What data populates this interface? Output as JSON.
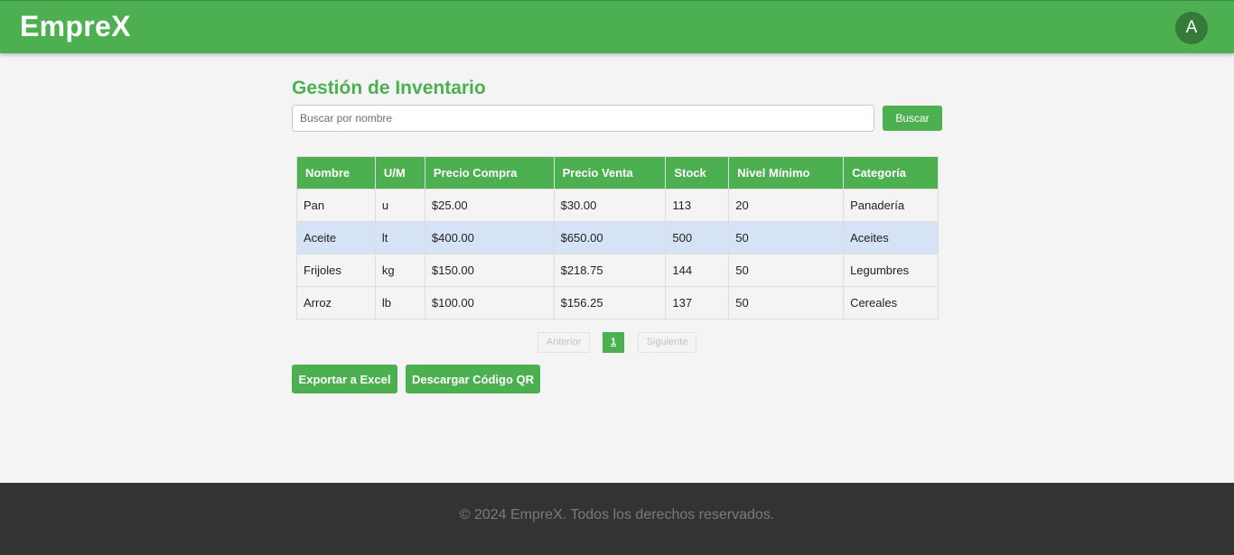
{
  "header": {
    "brand": "EmpreX",
    "avatar_initial": "A"
  },
  "main": {
    "title": "Gestión de Inventario",
    "search": {
      "placeholder": "Buscar por nombre",
      "value": "",
      "button_label": "Buscar"
    },
    "table": {
      "columns": [
        "Nombre",
        "U/M",
        "Precio Compra",
        "Precio Venta",
        "Stock",
        "Nivel Mínimo",
        "Categoría"
      ],
      "rows": [
        [
          "Pan",
          "u",
          "$25.00",
          "$30.00",
          "113",
          "20",
          "Panadería"
        ],
        [
          "Aceite",
          "lt",
          "$400.00",
          "$650.00",
          "500",
          "50",
          "Aceites"
        ],
        [
          "Frijoles",
          "kg",
          "$150.00",
          "$218.75",
          "144",
          "50",
          "Legumbres"
        ],
        [
          "Arroz",
          "lb",
          "$100.00",
          "$156.25",
          "137",
          "50",
          "Cereales"
        ]
      ]
    },
    "pagination": {
      "previous_label": "Anterior",
      "current_page": "1",
      "next_label": "Siguiente"
    },
    "actions": {
      "export_label": "Exportar a Excel",
      "qr_label": "Descargar Código QR"
    }
  },
  "footer": {
    "text": "© 2024 EmpreX. Todos los derechos reservados."
  },
  "colors": {
    "accent": "#4caf50",
    "highlight_row": "#d6e3f6",
    "footer_bg": "#333333"
  }
}
